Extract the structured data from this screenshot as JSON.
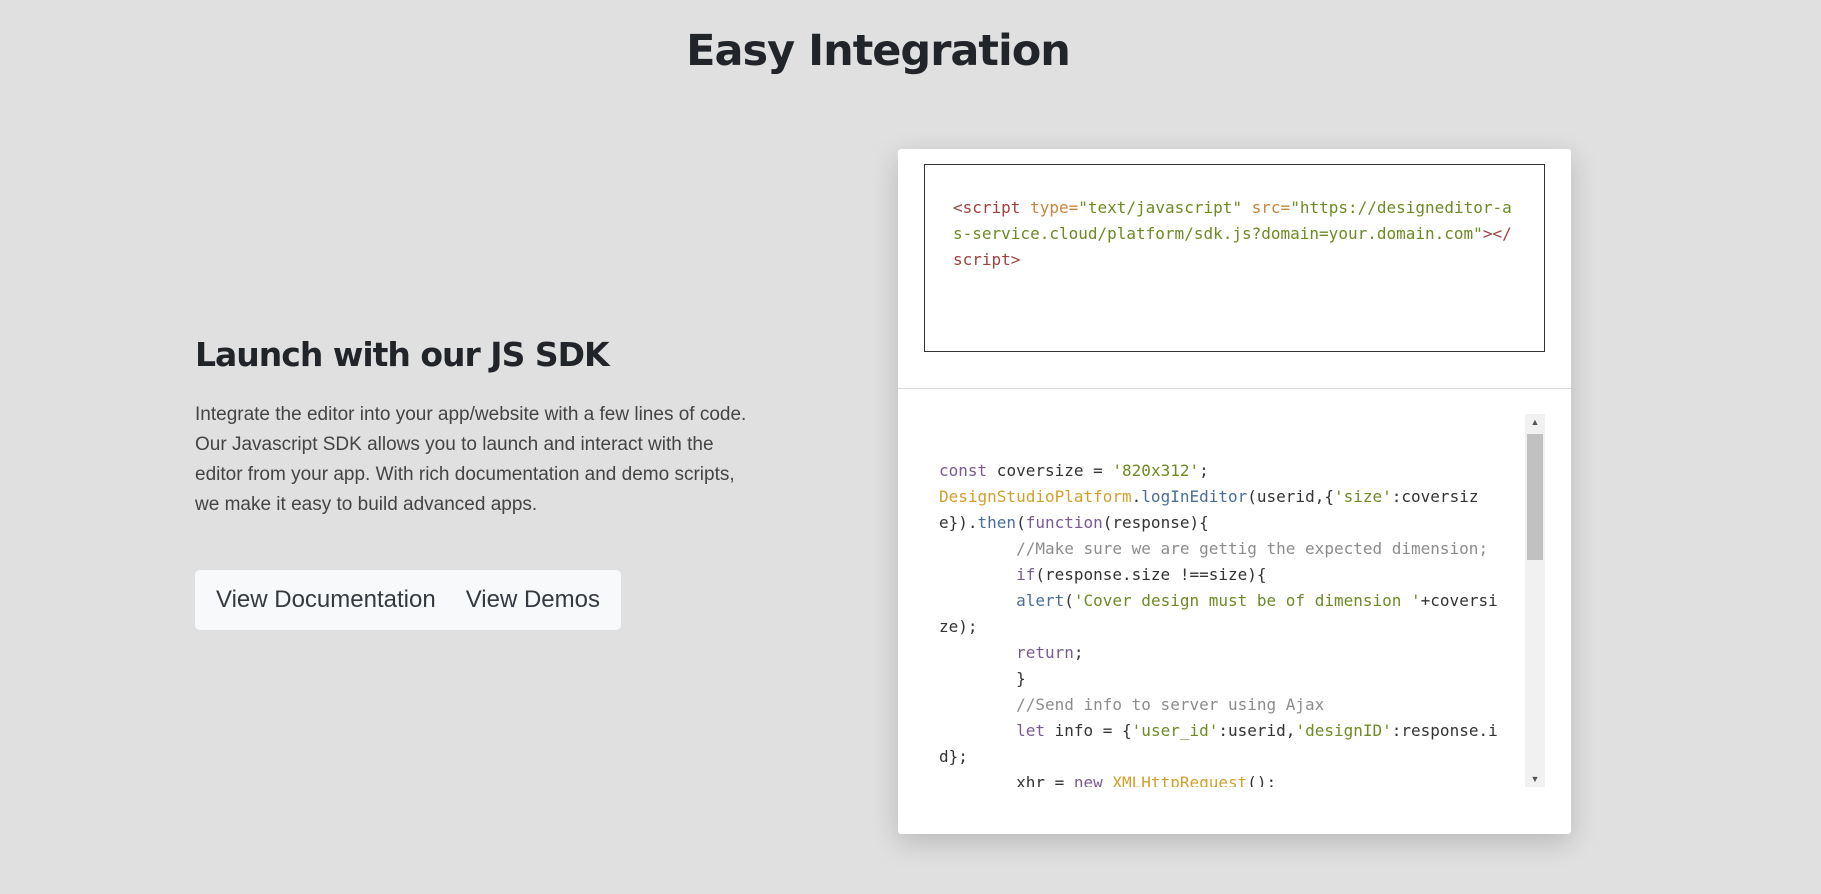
{
  "page_title": "Easy Integration",
  "sdk": {
    "heading": "Launch with our JS SDK",
    "description": "Integrate the editor into your app/website with a few lines of code. Our Javascript SDK allows you to launch and interact with the editor from your app. With rich documentation and demo scripts, we make it easy to build advanced apps.",
    "buttons": {
      "documentation": "View Documentation",
      "demos": "View Demos"
    }
  },
  "code_snippets": {
    "script_tag": {
      "open": "<",
      "tag": "script",
      "attr_type": "type=",
      "type_value": "\"text/javascript\"",
      "attr_src": "src=",
      "src_value": "\"https://designeditor-as-service.cloud/platform/sdk.js?domain=your.domain.com\"",
      "close": "></",
      "close_tag": "script",
      "end": ">"
    },
    "example": {
      "l1_kw": "const",
      "l1_rest": " coversize = ",
      "l1_str": "'820x312'",
      "l1_end": ";",
      "l2_cls": "DesignStudioPlatform",
      "l2_dot": ".",
      "l2_fn": "logInEditor",
      "l2_a": "(userid,{",
      "l2_str": "'size'",
      "l2_b": ":coversize}).",
      "l2_then": "then",
      "l2_c": "(",
      "l2_kw": "function",
      "l2_d": "(response){",
      "l3_indent": "        ",
      "l3_com": "//Make sure we are gettig the expected dimension;",
      "l4_indent": "        ",
      "l4_kw": "if",
      "l4_rest": "(response.size !==size){",
      "l5_indent": "        ",
      "l5_fn": "alert",
      "l5_a": "(",
      "l5_str": "'Cover design must be of dimension '",
      "l5_b": "+coversize);",
      "l6_indent": "        ",
      "l6_kw": "return",
      "l6_end": ";",
      "l7_text": "        }",
      "l8_indent": "        ",
      "l8_com": "//Send info to server using Ajax",
      "l9_indent": "        ",
      "l9_kw": "let",
      "l9_a": " info = {",
      "l9_str1": "'user_id'",
      "l9_b": ":userid,",
      "l9_str2": "'designID'",
      "l9_c": ":response.id};",
      "l10_indent": "        ",
      "l10_a": "xhr = ",
      "l10_kw": "new",
      "l10_sp": " ",
      "l10_cls": "XMLHttpRequest",
      "l10_b": "();"
    }
  },
  "scrollbar": {
    "up_arrow": "▲",
    "down_arrow": "▼"
  }
}
